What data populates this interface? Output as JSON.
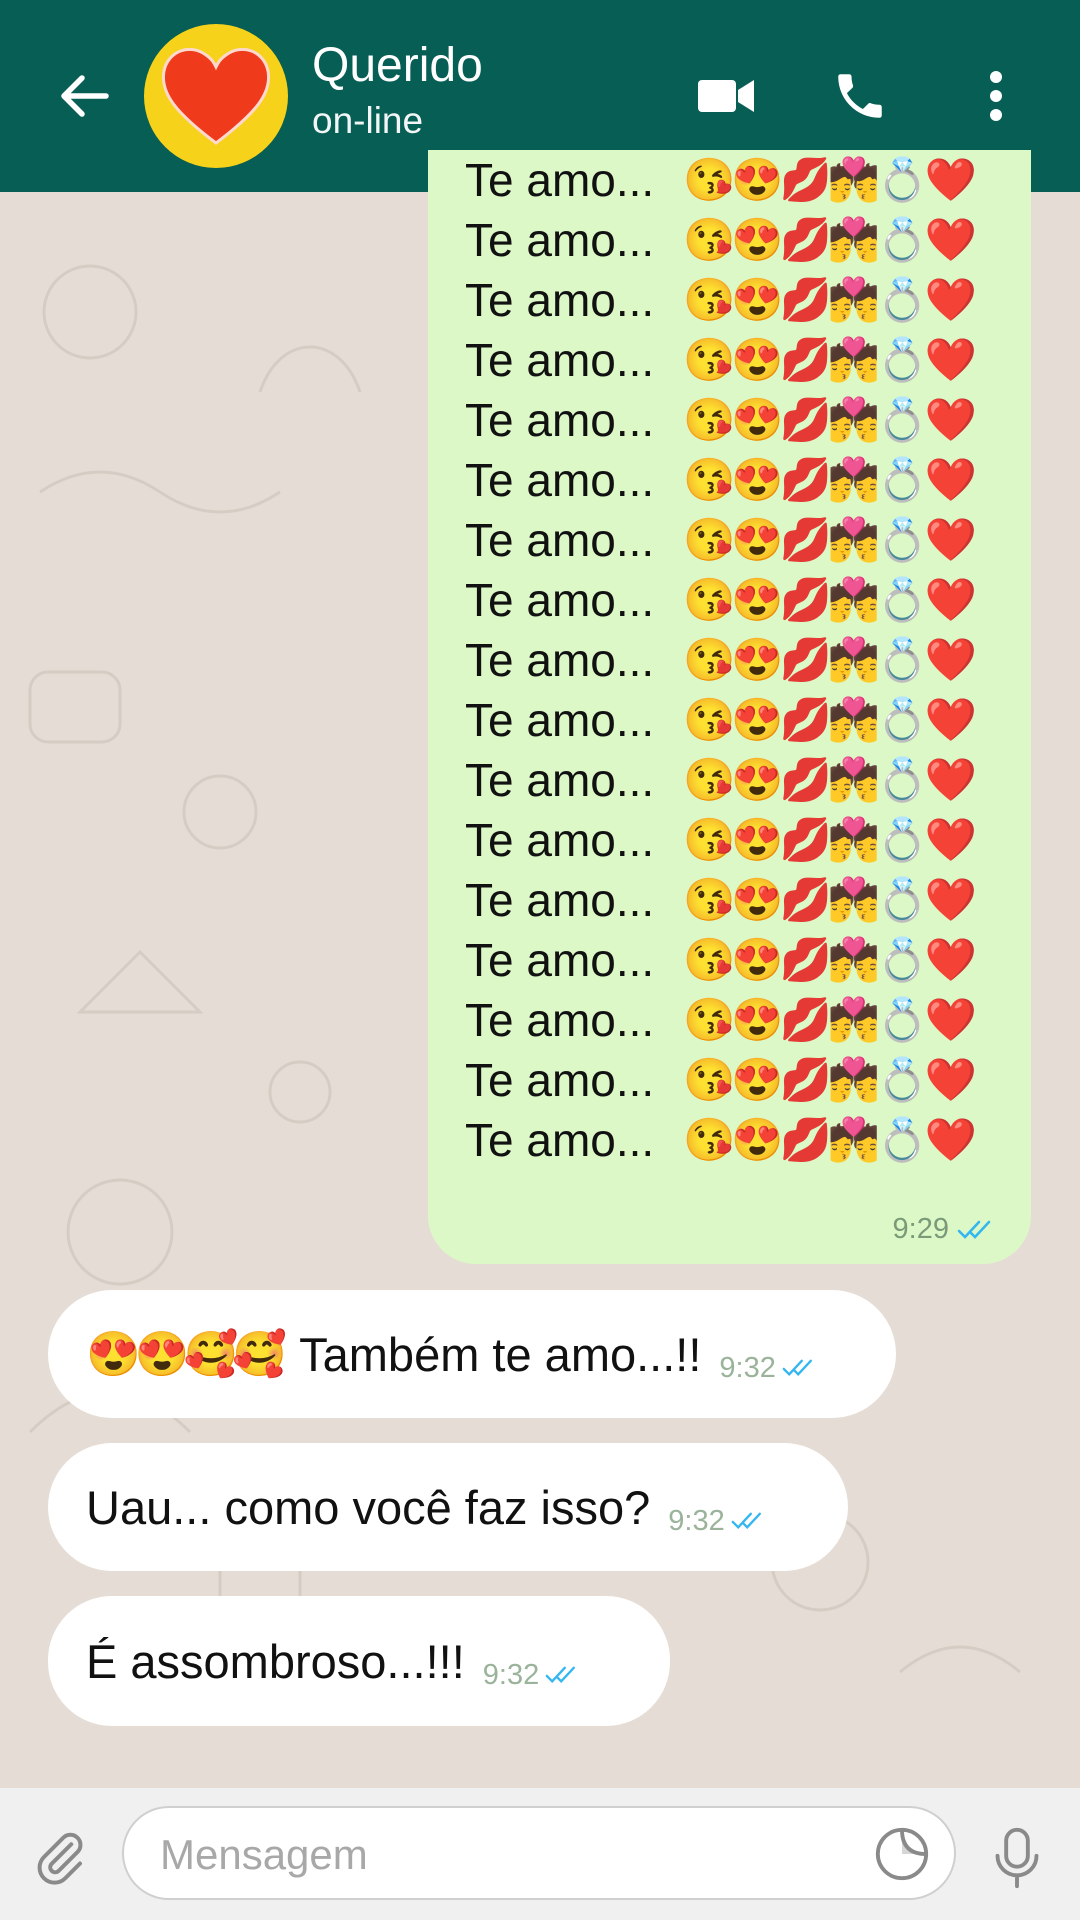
{
  "header": {
    "contact_name": "Querido",
    "contact_status": "on-line",
    "icons": [
      "back-arrow-icon",
      "video-call-icon",
      "voice-call-icon",
      "more-options-icon"
    ],
    "color": "#075e54"
  },
  "messages": {
    "outgoing": {
      "line_text": "Te amo...",
      "line_emojis": "😘😍💋💏💍❤️",
      "line_count": 17,
      "time": "9:29",
      "status": "read"
    },
    "incoming": [
      {
        "emoji": "😍😍🥰🥰",
        "text": "Também te amo...!!",
        "time": "9:32"
      },
      {
        "emoji": "",
        "text": "Uau... como você faz isso?",
        "time": "9:32"
      },
      {
        "emoji": "",
        "text": "É assombroso...!!!",
        "time": "9:32"
      }
    ],
    "outgoing_bubble_color": "#dcf8c6",
    "tick_color": "#34b7f1"
  },
  "composer": {
    "placeholder": "Mensagem",
    "icons": [
      "attach-icon",
      "sticker-icon",
      "mic-icon"
    ]
  }
}
